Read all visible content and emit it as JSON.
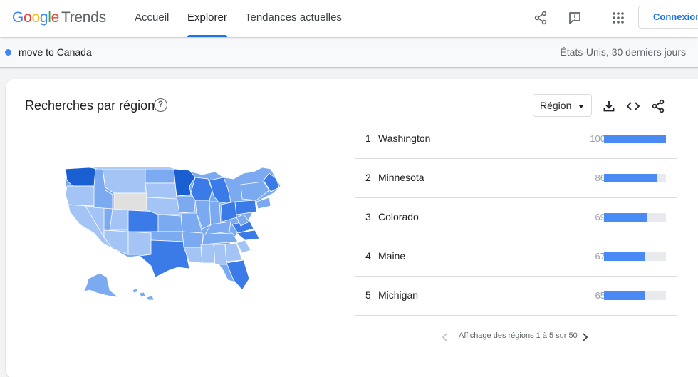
{
  "header": {
    "logo_google": [
      "G",
      "o",
      "o",
      "g",
      "l",
      "e"
    ],
    "logo_product": "Trends",
    "nav": [
      {
        "label": "Accueil",
        "active": false
      },
      {
        "label": "Explorer",
        "active": true
      },
      {
        "label": "Tendances actuelles",
        "active": false
      }
    ],
    "icons": [
      "share-icon",
      "feedback-icon",
      "apps-icon"
    ],
    "signin_label": "Connexion"
  },
  "query": {
    "term": "move to Canada",
    "term_color": "#4285f4",
    "meta": "États-Unis, 30 derniers jours"
  },
  "card": {
    "title": "Recherches par région",
    "help_glyph": "?",
    "region_select": "Région",
    "actions": [
      "download-icon",
      "embed-icon",
      "share-icon"
    ],
    "ranking": [
      {
        "rank": "1",
        "name": "Washington",
        "value": 100
      },
      {
        "rank": "2",
        "name": "Minnesota",
        "value": 86
      },
      {
        "rank": "3",
        "name": "Colorado",
        "value": 69
      },
      {
        "rank": "4",
        "name": "Maine",
        "value": 67
      },
      {
        "rank": "5",
        "name": "Michigan",
        "value": 65
      }
    ],
    "pager": {
      "text": "Affichage des régions 1 à 5 sur 50",
      "prev": "‹",
      "next": "›"
    },
    "bar_color": "#4a8af4",
    "map_colors": {
      "strong": "#1a5fd1",
      "mid": "#3b7be8",
      "light": "#7baaf0",
      "pale": "#a3c4f5",
      "no_data": "#e0e0e0"
    }
  }
}
